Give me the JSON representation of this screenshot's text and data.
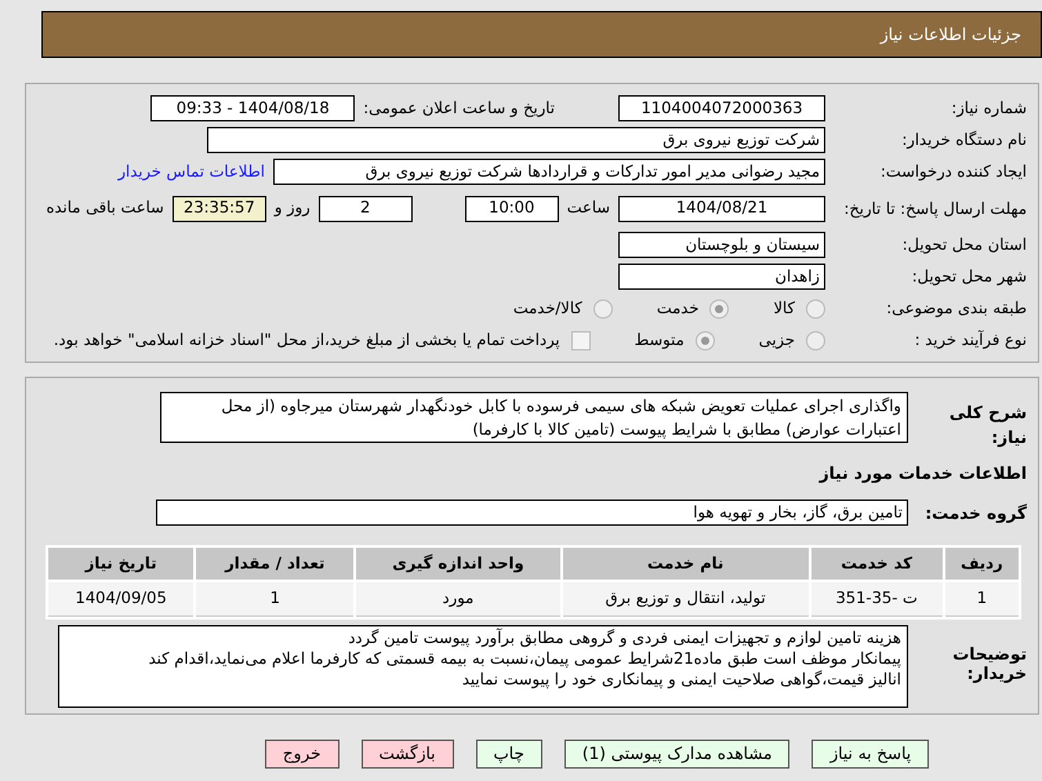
{
  "header": {
    "title": "جزئیات اطلاعات نیاز"
  },
  "details": {
    "need_number": {
      "label": "شماره نیاز:",
      "value": "1104004072000363"
    },
    "announce": {
      "label": "تاریخ و ساعت اعلان عمومی:",
      "value": "1404/08/18 - 09:33"
    },
    "buyer_org": {
      "label": "نام دستگاه خریدار:",
      "value": "شرکت توزیع نیروی برق"
    },
    "creator": {
      "label": "ایجاد کننده درخواست:",
      "value": "مجید  رضوانی مدیر امور تدارکات و قراردادها شرکت توزیع نیروی برق",
      "link": "اطلاعات تماس خریدار"
    },
    "deadline": {
      "label": "مهلت ارسال پاسخ: تا تاریخ:",
      "date": "1404/08/21",
      "time_label": "ساعت",
      "time": "10:00",
      "days": "2",
      "days_label": "روز و",
      "remaining": "23:35:57",
      "remaining_label": "ساعت باقی مانده"
    },
    "province": {
      "label": "استان محل تحویل:",
      "value": "سیستان و بلوچستان"
    },
    "city": {
      "label": "شهر محل تحویل:",
      "value": "زاهدان"
    },
    "category": {
      "label": "طبقه بندی موضوعی:",
      "options": [
        {
          "label": "کالا",
          "selected": false
        },
        {
          "label": "خدمت",
          "selected": true
        },
        {
          "label": "کالا/خدمت",
          "selected": false
        }
      ]
    },
    "purchase_type": {
      "label": "نوع فرآیند خرید :",
      "options": [
        {
          "label": "جزیی",
          "selected": false
        },
        {
          "label": "متوسط",
          "selected": true
        }
      ],
      "payment": {
        "checked": false,
        "text": "پرداخت تمام یا بخشی از مبلغ خرید،از محل \"اسناد خزانه اسلامی\" خواهد بود."
      }
    }
  },
  "need": {
    "description_label": "شرح کلی نیاز:",
    "description": "واگذاری اجرای عملیات تعویض شبکه های سیمی فرسوده با کابل خودنگهدار شهرستان میرجاوه (از محل اعتبارات عوارض) مطابق با شرایط پیوست (تامین کالا با کارفرما)",
    "services_heading": "اطلاعات خدمات مورد نیاز",
    "group_label": "گروه خدمت:",
    "group": "تامین برق، گاز، بخار و تهویه هوا",
    "table": {
      "columns": [
        "ردیف",
        "کد خدمت",
        "نام خدمت",
        "واحد اندازه گیری",
        "تعداد / مقدار",
        "تاریخ نیاز"
      ],
      "rows": [
        [
          "1",
          "ت -35-351",
          "تولید، انتقال و توزیع برق",
          "مورد",
          "1",
          "1404/09/05"
        ]
      ]
    },
    "notes_label": "توضیحات خریدار:",
    "notes": [
      "هزینه تامین لوازم و تجهیزات ایمنی فردی و گروهی مطابق برآورد پیوست تامین گردد",
      "پیمانکار موظف است طبق ماده21شرایط عمومی پیمان،نسبت به بیمه قسمتی که کارفرما اعلام می‌نماید،اقدام کند",
      "انالیز قیمت،گواهی صلاحیت ایمنی و پیمانکاری خود را پیوست نمایید"
    ]
  },
  "buttons": [
    {
      "label": "پاسخ به نیاز",
      "kind": "action"
    },
    {
      "label": "مشاهده مدارک پیوستی (1)",
      "kind": "action"
    },
    {
      "label": "چاپ",
      "kind": "action"
    },
    {
      "label": "بازگشت",
      "kind": "exit"
    },
    {
      "label": "خروج",
      "kind": "exit"
    }
  ]
}
